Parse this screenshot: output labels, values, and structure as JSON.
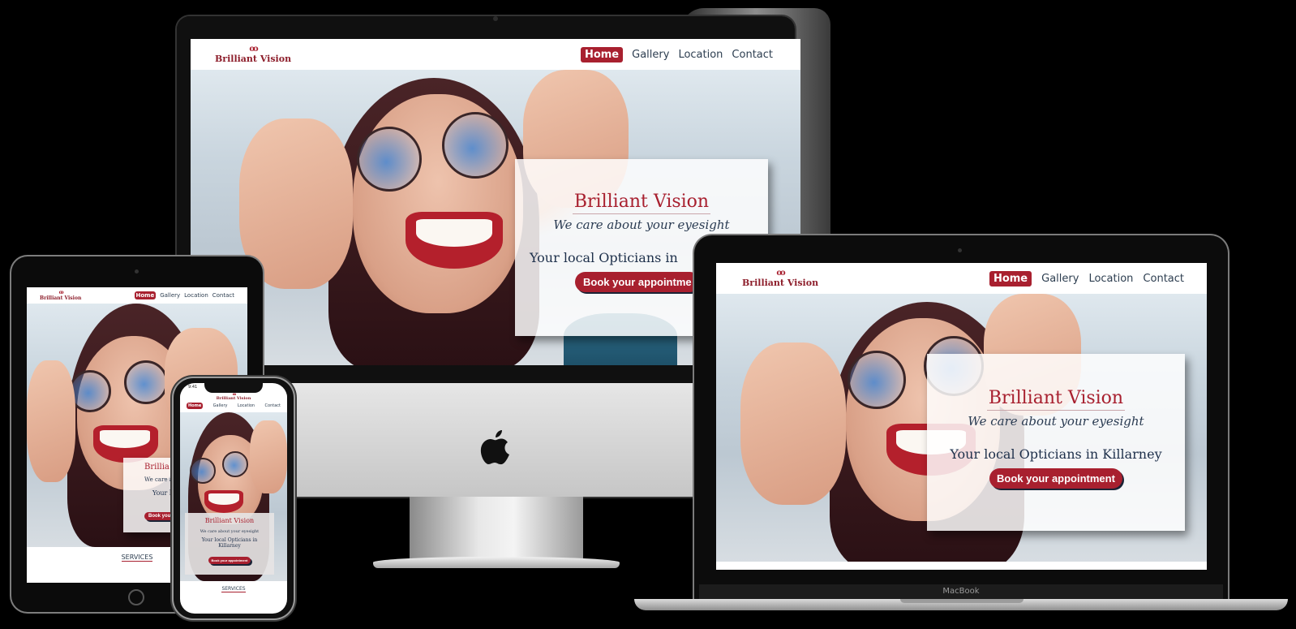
{
  "site": {
    "brand": "Brilliant Vision",
    "brand_mark": "oo",
    "nav": [
      "Home",
      "Gallery",
      "Location",
      "Contact"
    ],
    "hero_title": "Brilliant Vision",
    "hero_tagline": "We care about your eyesight",
    "hero_local": "Your local Opticians in Killarney",
    "hero_button": "Book your appointment",
    "services_link": "SERVICES"
  },
  "imac": {
    "hero_local_visible": "Your local Opticians in",
    "hero_button_visible": "Book your appointme"
  },
  "tablet": {
    "hero_title_visible": "Brillia",
    "hero_tagline_visible": "We care abo",
    "hero_local_line1_visible": "Your local",
    "hero_local_line2_visible": "Kil",
    "hero_button_visible": "Book you"
  },
  "phone": {
    "time": "9:41",
    "hero_local_line1": "Your local Opticians in",
    "hero_local_line2": "Killarney"
  },
  "laptop": {
    "device_label": "MacBook"
  },
  "colors": {
    "accent": "#a8202f",
    "navy": "#1d2f4a",
    "background": "#000000"
  },
  "icons": {
    "apple_logo": "apple-logo-icon",
    "brand_mark": "glasses-icon"
  }
}
